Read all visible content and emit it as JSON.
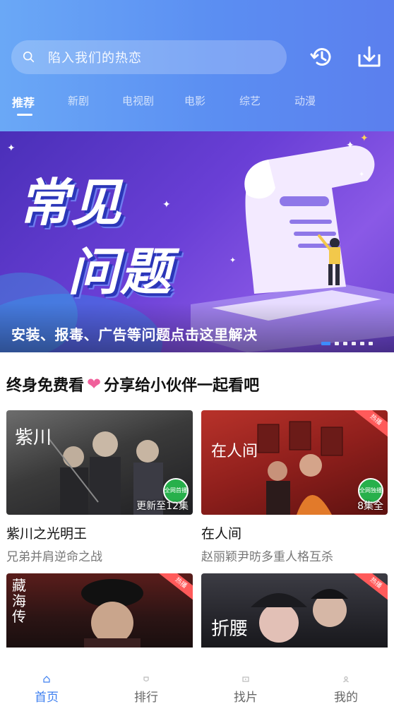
{
  "search": {
    "placeholder": "陷入我们的热恋"
  },
  "header_icons": {
    "history": "history-icon",
    "download": "download-icon"
  },
  "tabs": [
    {
      "label": "推荐",
      "active": true
    },
    {
      "label": "新剧",
      "active": false
    },
    {
      "label": "电视剧",
      "active": false
    },
    {
      "label": "电影",
      "active": false
    },
    {
      "label": "综艺",
      "active": false
    },
    {
      "label": "动漫",
      "active": false
    }
  ],
  "banner": {
    "title_line1": "常见",
    "title_line2": "问题",
    "caption": "安装、报毒、广告等问题点击这里解决",
    "slide_count": 6,
    "active_slide": 1
  },
  "section": {
    "title_left": "终身免费看",
    "heart": "❤",
    "title_right": "分享给小伙伴一起看吧"
  },
  "cards": [
    {
      "name": "紫川之光明王",
      "desc": "兄弟并肩逆命之战",
      "episode": "更新至12集",
      "poster_title": "紫川",
      "badge": "全网首播",
      "hot": ""
    },
    {
      "name": "在人间",
      "desc": "赵丽颖尹昉多重人格互杀",
      "episode": "8集全",
      "poster_title": "在人间",
      "badge": "全网独播",
      "hot": "热播"
    },
    {
      "name": "",
      "desc": "",
      "episode": "",
      "poster_title": "藏海传",
      "badge": "",
      "hot": "热播"
    },
    {
      "name": "",
      "desc": "",
      "episode": "",
      "poster_title": "折腰",
      "badge": "",
      "hot": "热播"
    }
  ],
  "bottom_nav": [
    {
      "label": "首页",
      "icon": "home-icon",
      "active": true
    },
    {
      "label": "排行",
      "icon": "ranking-icon",
      "active": false
    },
    {
      "label": "找片",
      "icon": "find-icon",
      "active": false
    },
    {
      "label": "我的",
      "icon": "profile-icon",
      "active": false
    }
  ],
  "colors": {
    "accent": "#3d7ff0",
    "header_start": "#6aa8f6",
    "header_end": "#5b7fee",
    "heart": "#f0609b",
    "hot": "#ff5a5a"
  }
}
